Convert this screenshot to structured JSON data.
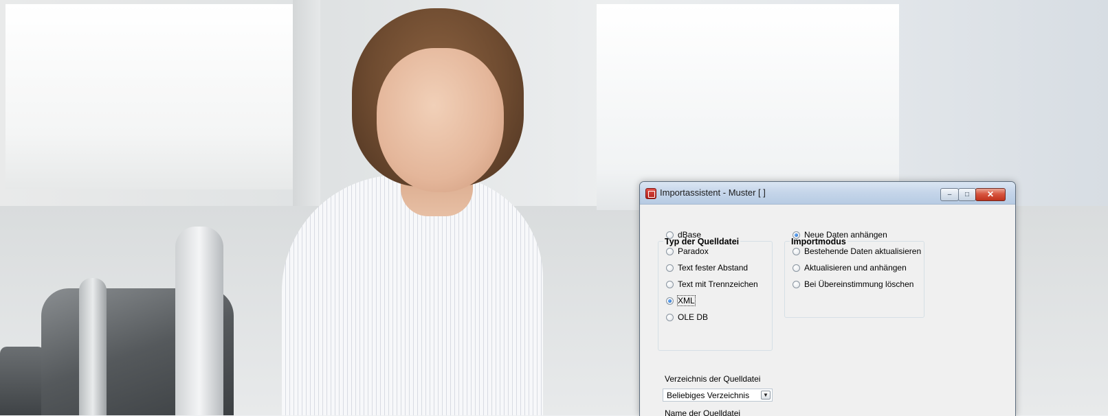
{
  "window": {
    "title": "Importassistent - Muster [  ]",
    "icon": "app-icon",
    "buttons": {
      "minimize": "–",
      "maximize": "□",
      "close": "✕"
    }
  },
  "source_type": {
    "title": "Typ der Quelldatei",
    "options": [
      {
        "label": "dBase",
        "selected": false
      },
      {
        "label": "Paradox",
        "selected": false
      },
      {
        "label": "Text fester Abstand",
        "selected": false
      },
      {
        "label": "Text mit Trennzeichen",
        "selected": false
      },
      {
        "label": "XML",
        "selected": true
      },
      {
        "label": "OLE DB",
        "selected": false
      }
    ]
  },
  "import_mode": {
    "title": "Importmodus",
    "options": [
      {
        "label": "Neue Daten anhängen",
        "selected": true
      },
      {
        "label": "Bestehende Daten aktualisieren",
        "selected": false
      },
      {
        "label": "Aktualisieren und anhängen",
        "selected": false
      },
      {
        "label": "Bei Übereinstimmung löschen",
        "selected": false
      }
    ]
  },
  "source_directory": {
    "label": "Verzeichnis der Quelldatei",
    "value": "Beliebiges Verzeichnis"
  },
  "source_name": {
    "label": "Name der Quelldatei",
    "value": ""
  }
}
